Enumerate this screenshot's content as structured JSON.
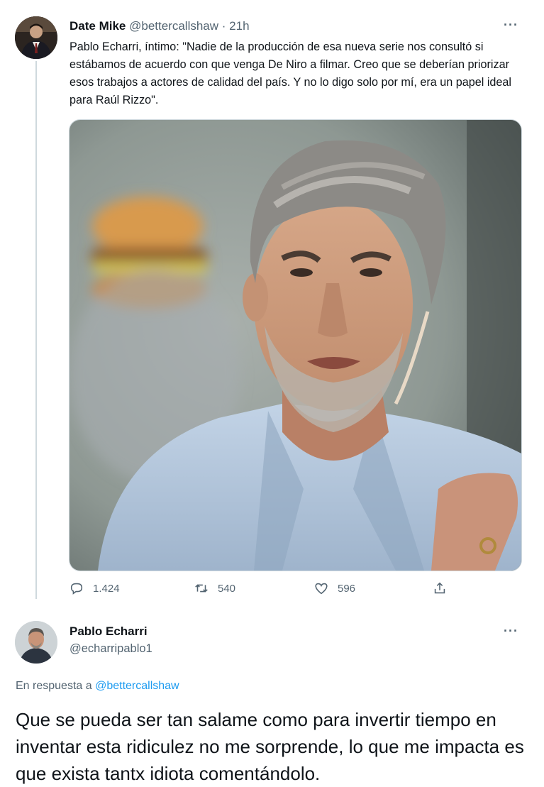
{
  "tweet1": {
    "display_name": "Date Mike",
    "handle": "@bettercallshaw",
    "separator": " · ",
    "time": "21h",
    "text": "Pablo Echarri, íntimo: \"Nadie de la producción de esa nueva serie nos consultó si estábamos de acuerdo con que venga De Niro a filmar. Creo que se deberían priorizar esos trabajos a actores de calidad del país. Y no lo digo solo por mí, era un papel ideal para Raúl Rizzo\".",
    "more_label": "···",
    "replies": "1.424",
    "retweets": "540",
    "likes": "596"
  },
  "tweet2": {
    "display_name": "Pablo Echarri",
    "handle": "@echarripablo1",
    "more_label": "···",
    "reply_prefix": "En respuesta a ",
    "reply_mention": "@bettercallshaw",
    "text": "Que se pueda ser tan salame como para invertir tiempo en inventar esta ridiculez no me sorprende, lo que me impacta es que exista tantx idiota comentándolo."
  },
  "colors": {
    "text": "#0f1419",
    "secondary": "#536471",
    "link": "#1d9bf0",
    "thread_line": "#cfd9de"
  },
  "icons": [
    "reply-icon",
    "retweet-icon",
    "like-icon",
    "share-icon",
    "more-icon"
  ]
}
